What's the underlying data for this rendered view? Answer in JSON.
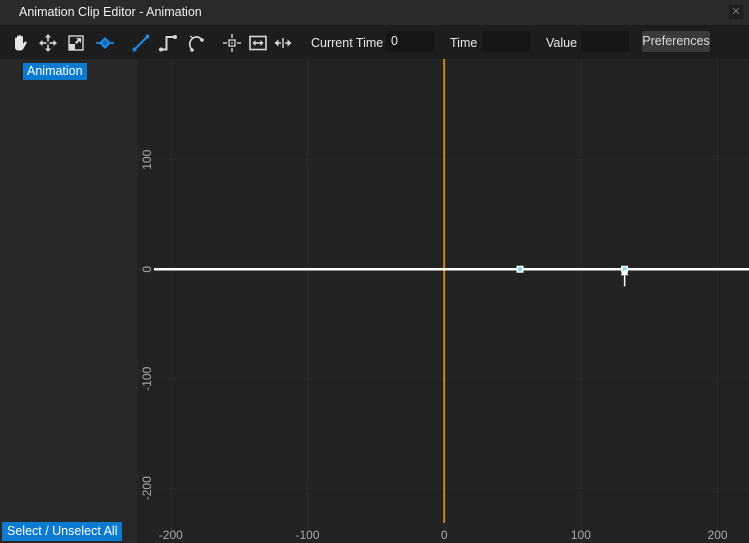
{
  "window": {
    "title": "Animation Clip Editor - Animation",
    "close_icon": "close-icon"
  },
  "toolbar": {
    "tools": [
      {
        "name": "pan-tool",
        "icon": "hand-icon",
        "active": false
      },
      {
        "name": "move-tool",
        "icon": "move-arrows-icon",
        "active": false
      },
      {
        "name": "scale-tool",
        "icon": "scale-icon",
        "active": false
      },
      {
        "name": "keyframe-tool",
        "icon": "keyframe-diamond-icon",
        "active": true
      },
      {
        "name": "linear-interpolation",
        "icon": "linear-curve-icon",
        "active": true
      },
      {
        "name": "step-interpolation",
        "icon": "step-curve-icon",
        "active": false
      },
      {
        "name": "bezier-interpolation",
        "icon": "bezier-curve-icon",
        "active": false
      },
      {
        "name": "center-view",
        "icon": "center-crosshair-icon",
        "active": false
      },
      {
        "name": "fit-view",
        "icon": "fit-horizontal-icon",
        "active": false
      },
      {
        "name": "spread-keys",
        "icon": "spread-arrows-icon",
        "active": false
      }
    ],
    "current_time_label": "Current Time",
    "current_time_value": "0",
    "time_label": "Time",
    "time_value": "",
    "value_label": "Value",
    "value_value": "",
    "preferences_label": "Preferences"
  },
  "sidebar": {
    "curves": [
      {
        "label": "Animation",
        "selected": true
      }
    ],
    "select_all_label": "Select / Unselect All"
  },
  "colors": {
    "accent": "#0a7bd0",
    "playhead": "#c8861e",
    "curve": "#ffffff",
    "keyframe_fill": "#7fd8f0"
  },
  "chart_data": {
    "type": "line",
    "title": "",
    "xlabel": "",
    "ylabel": "",
    "x_ticks": [
      "-200",
      "-100",
      "0",
      "100",
      "200"
    ],
    "y_ticks": [
      "100",
      "0",
      "-100",
      "-200"
    ],
    "x_tick_values": [
      -200,
      -100,
      0,
      100,
      200
    ],
    "y_tick_values": [
      100,
      0,
      -100,
      -200
    ],
    "xlim": [
      -224,
      223
    ],
    "ylim": [
      -250,
      192
    ],
    "grid": true,
    "playhead_time": 0,
    "series": [
      {
        "name": "Animation",
        "keyframes": [
          {
            "x": 55.5,
            "y": 0,
            "selected": false
          },
          {
            "x": 132,
            "y": 0,
            "selected": true
          }
        ],
        "extends_before": true,
        "extends_after": true
      }
    ]
  }
}
